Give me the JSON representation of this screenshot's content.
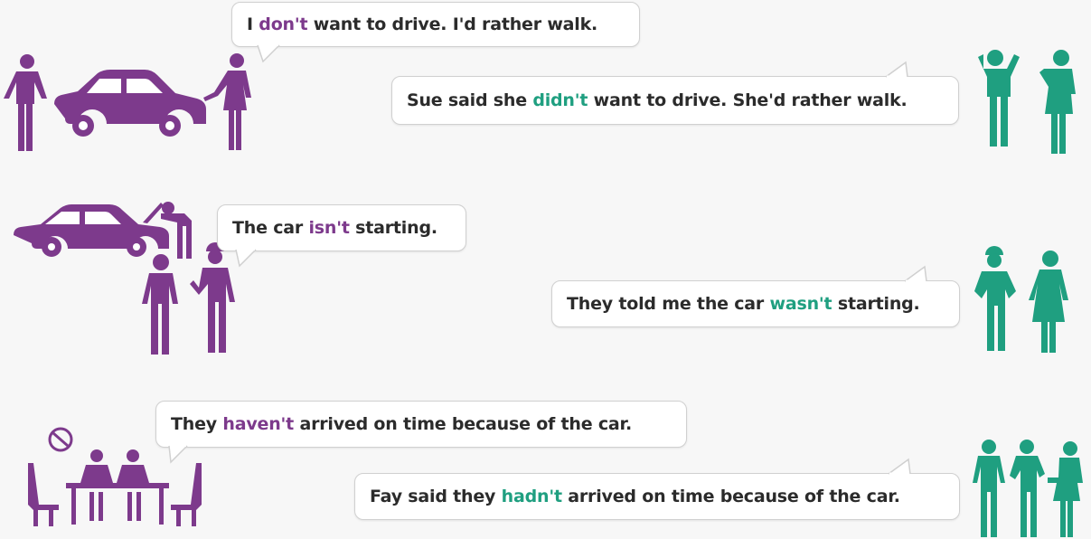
{
  "colors": {
    "purple": "#7d3a8c",
    "green": "#1f9f80",
    "text": "#2b2b2b",
    "bubble_border": "#d0d0d0"
  },
  "rows": [
    {
      "direct": {
        "pre": "I ",
        "highlight": "don't",
        "post": " want to drive. I'd rather walk."
      },
      "reported": {
        "pre": "Sue said she ",
        "highlight": "didn't",
        "post": " want to drive. She'd rather walk."
      }
    },
    {
      "direct": {
        "pre": "The car ",
        "highlight": "isn't",
        "post": " starting."
      },
      "reported": {
        "pre": "They told me the car ",
        "highlight": "wasn't",
        "post": " starting."
      }
    },
    {
      "direct": {
        "pre": "They ",
        "highlight": "haven't",
        "post": " arrived on time because of the car."
      },
      "reported": {
        "pre": "Fay said they ",
        "highlight": "hadn't",
        "post": " arrived on time because of the car."
      }
    }
  ],
  "icons": {
    "row1_direct": "man-woman-car-icon",
    "row1_reported": "two-people-icon",
    "row2_direct": "broken-car-mechanic-icon",
    "row2_reported": "mechanic-woman-icon",
    "row3_direct": "meeting-table-clock-icon",
    "row3_reported": "three-people-icon"
  }
}
